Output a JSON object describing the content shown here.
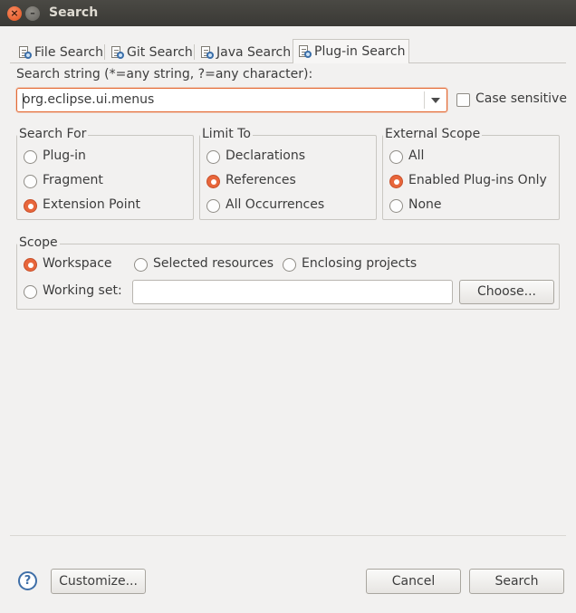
{
  "window": {
    "title": "Search",
    "close_glyph": "×",
    "min_glyph": "–"
  },
  "tabs": [
    {
      "label": "File Search",
      "icon": "file-search-icon"
    },
    {
      "label": "Git Search",
      "icon": "git-search-icon"
    },
    {
      "label": "Java Search",
      "icon": "java-search-icon"
    },
    {
      "label": "Plug-in Search",
      "icon": "plugin-search-icon",
      "active": true
    }
  ],
  "search": {
    "label": "Search string (*=any string, ?=any character):",
    "value": "org.eclipse.ui.menus",
    "case_sensitive_label": "Case sensitive",
    "case_sensitive": false
  },
  "search_for": {
    "title": "Search For",
    "options": [
      "Plug-in",
      "Fragment",
      "Extension Point"
    ],
    "selected": "Extension Point"
  },
  "limit_to": {
    "title": "Limit To",
    "options": [
      "Declarations",
      "References",
      "All Occurrences"
    ],
    "selected": "References"
  },
  "external_scope": {
    "title": "External Scope",
    "options": [
      "All",
      "Enabled Plug-ins Only",
      "None"
    ],
    "selected": "Enabled Plug-ins Only"
  },
  "scope": {
    "title": "Scope",
    "workspace": "Workspace",
    "selected_resources": "Selected resources",
    "enclosing_projects": "Enclosing projects",
    "working_set": "Working set:",
    "working_set_value": "",
    "choose_button": "Choose...",
    "selected": "Workspace"
  },
  "footer": {
    "help_glyph": "?",
    "customize_button": "Customize...",
    "cancel_button": "Cancel",
    "search_button": "Search"
  },
  "colors": {
    "accent": "#e8663b",
    "titlebar": "#3c3b37",
    "background": "#f2f1f0"
  }
}
